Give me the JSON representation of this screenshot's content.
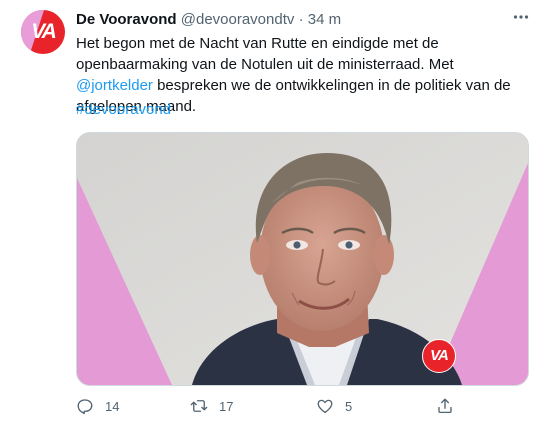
{
  "tweet": {
    "author_name": "De Vooravond",
    "handle": "@devooravondtv",
    "separator": "·",
    "time": "34 m",
    "avatar_text": "VA",
    "text_part1": "Het begon met de Nacht van Rutte en eindigde met de openbaarmaking van de Notulen uit de ministerraad. Met ",
    "mention": "@jortkelder",
    "text_part2": " bespreken we de ontwikkelingen in de politiek van de afgelopen maand.",
    "hashtag": "#devooravond",
    "media_badge_text": "VA"
  },
  "actions": {
    "replies": "14",
    "retweets": "17",
    "likes": "5"
  },
  "colors": {
    "brand_red": "#e8232a",
    "brand_pink": "#e89cd8",
    "link_blue": "#1d9bf0",
    "muted": "#536471"
  },
  "icons": [
    "more-icon",
    "reply-icon",
    "retweet-icon",
    "like-icon",
    "share-icon"
  ]
}
